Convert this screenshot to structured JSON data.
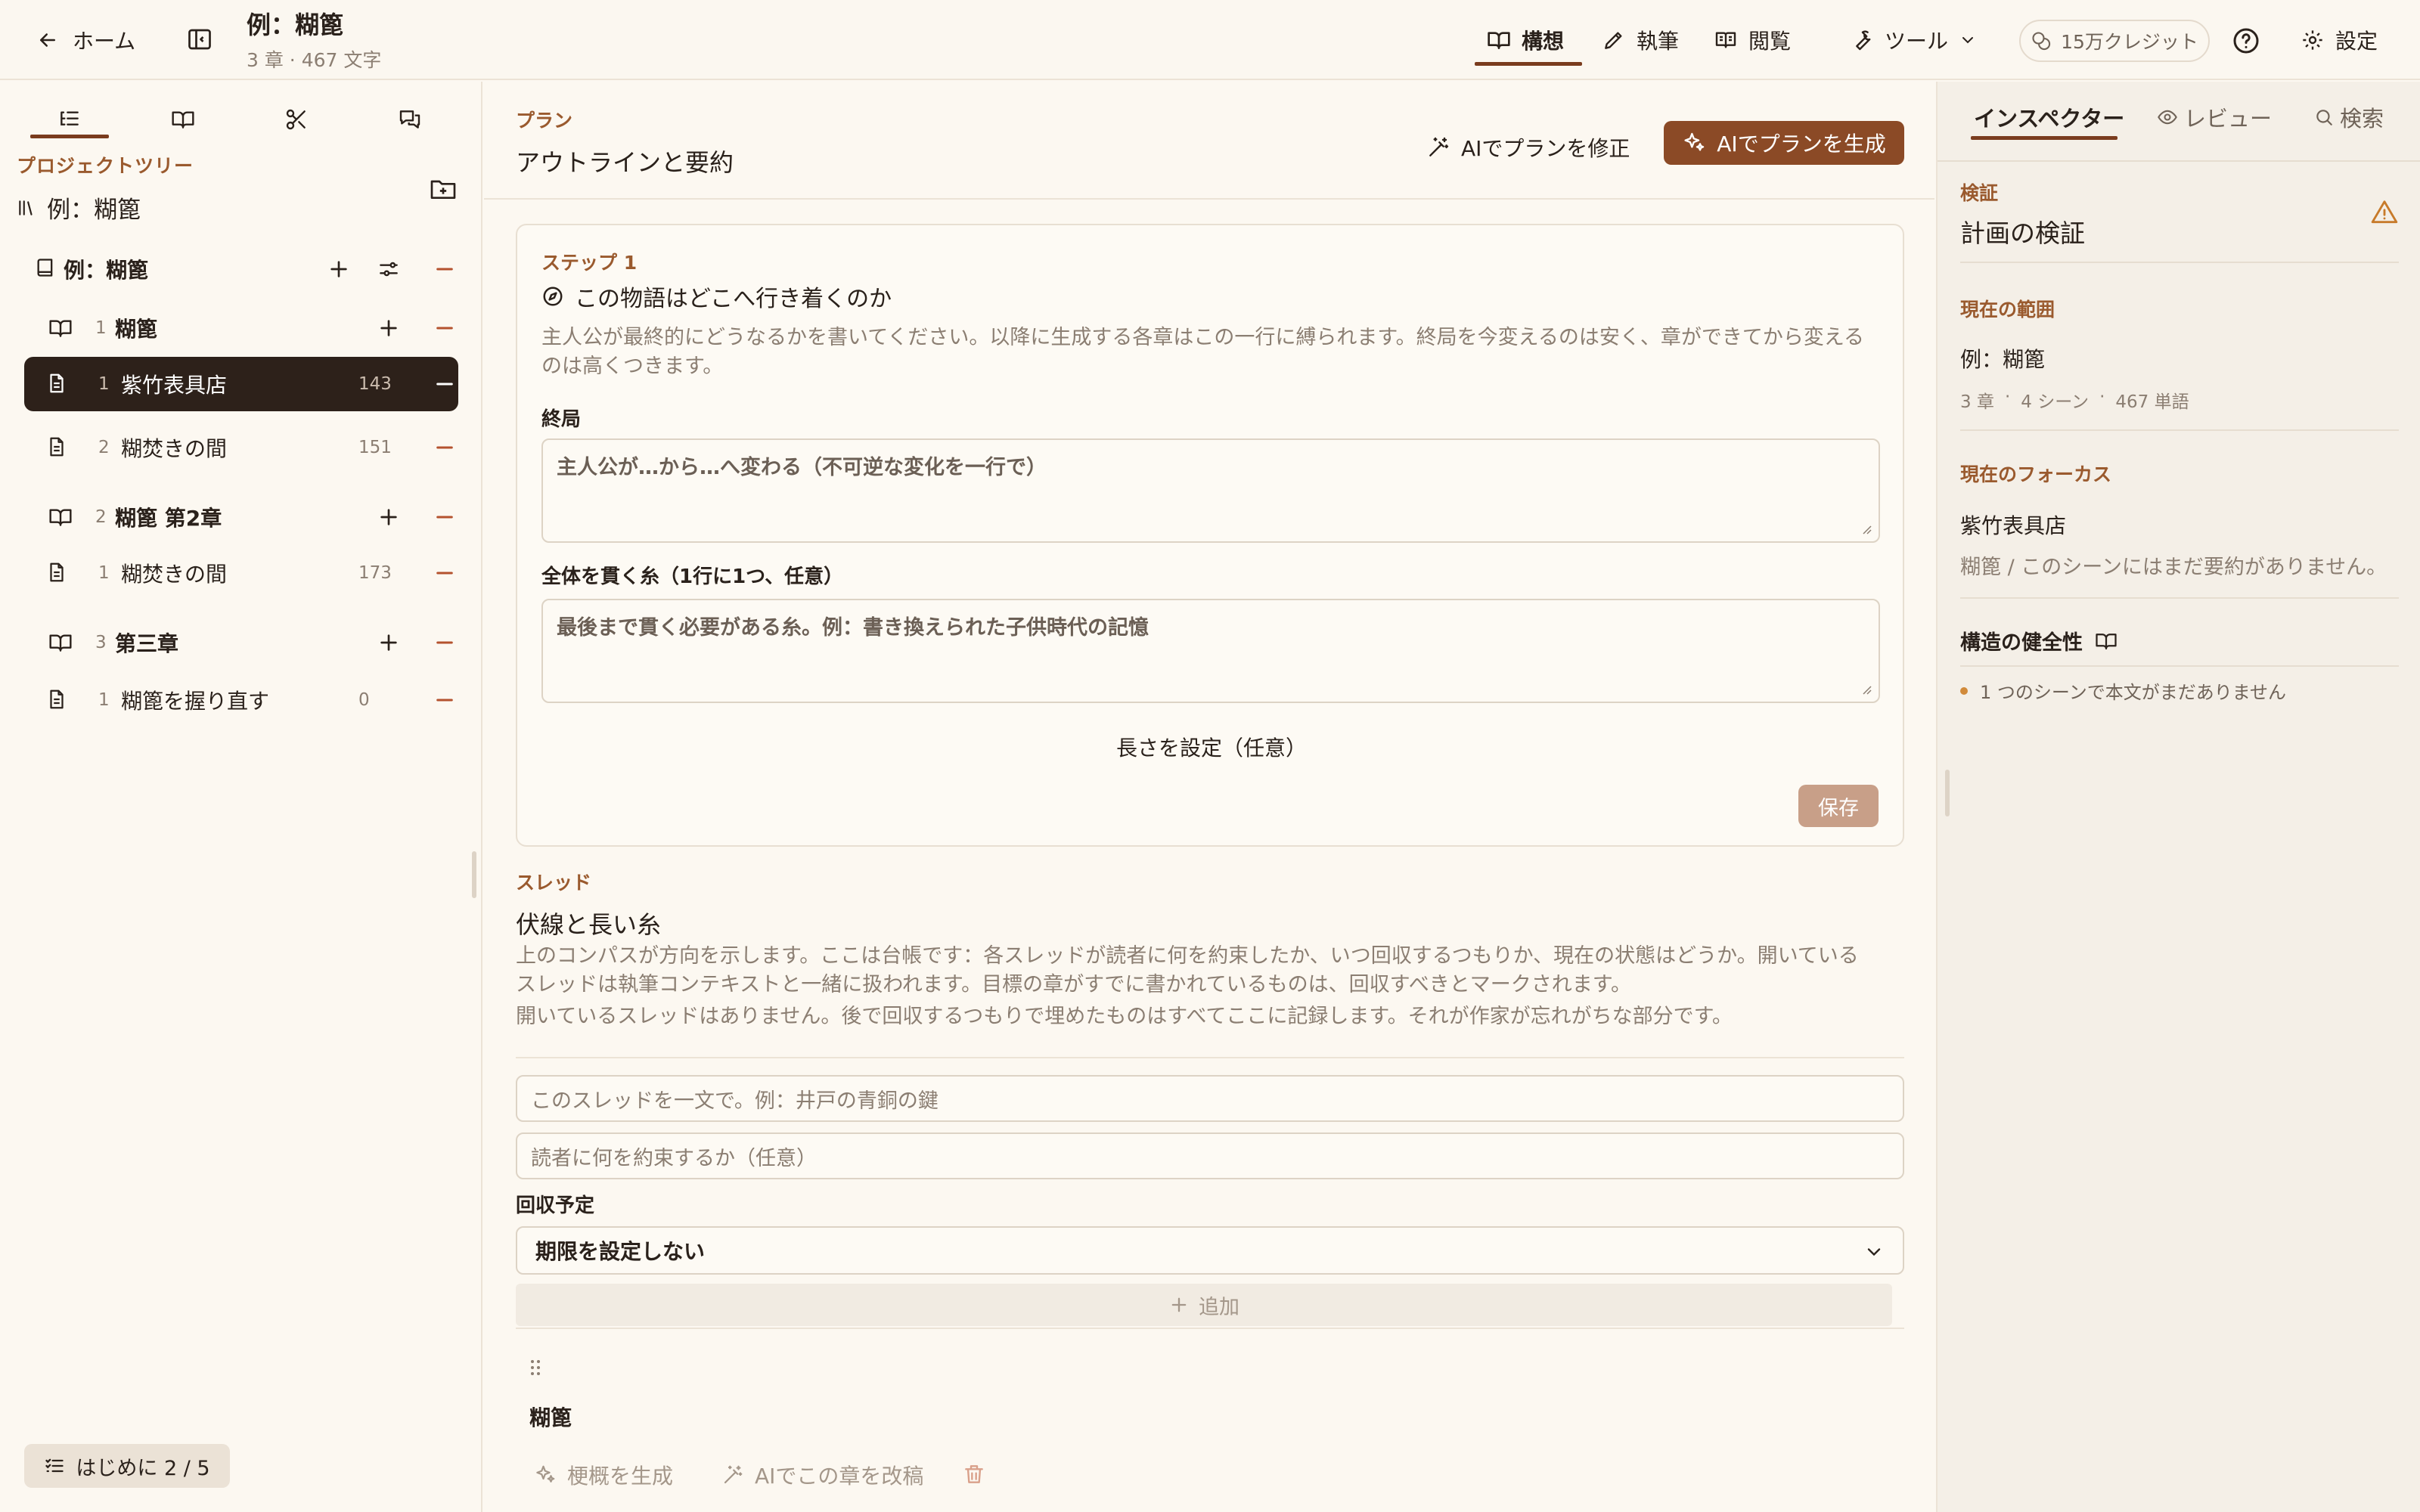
{
  "colors": {
    "accent": "#9a5a2e",
    "primary_button": "#8b4a26",
    "active_row": "#2d211a",
    "remove": "#b4522e",
    "warning": "#c77a2a"
  },
  "header": {
    "home_label": "ホーム",
    "title": "例：糊篦",
    "meta": "3 章 · 467 文字",
    "tabs": [
      {
        "label": "構想",
        "icon": "book-open-icon",
        "active": true
      },
      {
        "label": "執筆",
        "icon": "pencil-icon",
        "active": false
      },
      {
        "label": "閲覧",
        "icon": "reader-icon",
        "active": false
      }
    ],
    "tools_label": "ツール",
    "credits_label": "15万クレジット",
    "settings_label": "設定"
  },
  "sidebar": {
    "heading": "プロジェクトツリー",
    "root_label": "例：糊篦",
    "book": {
      "label": "例：糊篦"
    },
    "items": [
      {
        "kind": "chapter",
        "num": "1",
        "label": "糊篦"
      },
      {
        "kind": "scene",
        "num": "1",
        "label": "紫竹表具店",
        "count": "143",
        "active": true
      },
      {
        "kind": "scene",
        "num": "2",
        "label": "糊焚きの間",
        "count": "151"
      },
      {
        "kind": "chapter",
        "num": "2",
        "label": "糊篦 第2章"
      },
      {
        "kind": "scene",
        "num": "1",
        "label": "糊焚きの間",
        "count": "173"
      },
      {
        "kind": "chapter",
        "num": "3",
        "label": "第三章"
      },
      {
        "kind": "scene",
        "num": "1",
        "label": "糊篦を握り直す",
        "count": "0"
      }
    ],
    "getting_started": "はじめに 2 / 5"
  },
  "main": {
    "plan_kicker": "プラン",
    "plan_title": "アウトラインと要約",
    "ai_revise_label": "AIでプランを修正",
    "ai_generate_label": "AIでプランを生成",
    "step": {
      "kicker": "ステップ 1",
      "question": "この物語はどこへ行き着くのか",
      "description": "主人公が最終的にどうなるかを書いてください。以降に生成する各章はこの一行に縛られます。終局を今変えるのは安く、章ができてから変えるのは高くつきます。",
      "ending_label": "終局",
      "ending_placeholder": "主人公が…から…へ変わる（不可逆な変化を一行で）",
      "threads_label": "全体を貫く糸（1行に1つ、任意）",
      "threads_placeholder": "最後まで貫く必要がある糸。例：書き換えられた子供時代の記憶",
      "length_label": "長さを設定（任意）",
      "save_label": "保存"
    },
    "threads": {
      "kicker": "スレッド",
      "title": "伏線と長い糸",
      "description": "上のコンパスが方向を示します。ここは台帳です：各スレッドが読者に何を約束したか、いつ回収するつもりか、現在の状態はどうか。開いているスレッドは執筆コンテキストと一緒に扱われます。目標の章がすでに書かれているものは、回収すべきとマークされます。",
      "empty": "開いているスレッドはありません。後で回収するつもりで埋めたものはすべてここに記録します。それが作家が忘れがちな部分です。",
      "thread_placeholder": "このスレッドを一文で。例：井戸の青銅の鍵",
      "promise_placeholder": "読者に何を約束するか（任意）",
      "payoff_label": "回収予定",
      "payoff_value": "期限を設定しない",
      "add_label": "追加"
    },
    "chapter": {
      "title": "糊篦",
      "gen_synopsis_label": "梗概を生成",
      "ai_rewrite_label": "AIでこの章を改稿"
    }
  },
  "inspector": {
    "tabs": {
      "inspector": "インスペクター",
      "review": "レビュー",
      "search": "検索"
    },
    "verify_kicker": "検証",
    "verify_title": "計画の検証",
    "scope_kicker": "現在の範囲",
    "scope_name": "例：糊篦",
    "scope_chapters": "3 章",
    "scope_scenes": "4 シーン",
    "scope_words": "467 単語",
    "focus_kicker": "現在のフォーカス",
    "focus_name": "紫竹表具店",
    "focus_desc": "糊篦 / このシーンにはまだ要約がありません。",
    "health_title": "構造の健全性",
    "health_item": "1 つのシーンで本文がまだありません"
  }
}
